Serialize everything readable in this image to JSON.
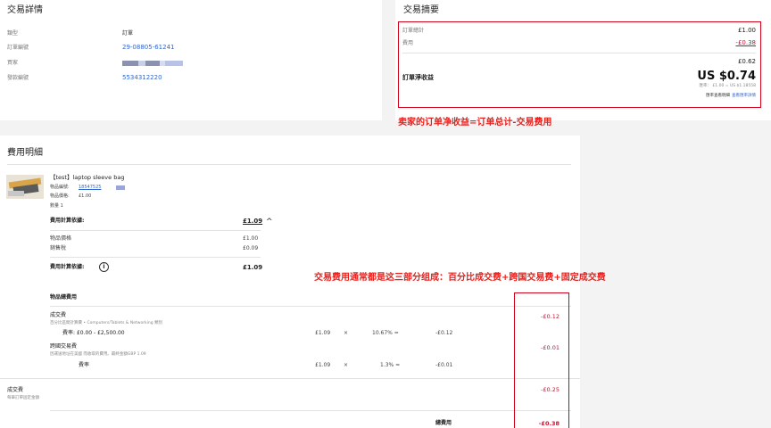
{
  "details": {
    "title": "交易詳情",
    "rows": [
      {
        "label": "類型",
        "value": "訂單"
      },
      {
        "label": "訂單編號",
        "value": "29-08805-61241"
      },
      {
        "label": "買家",
        "value": ""
      },
      {
        "label": "發款編號",
        "value": "5534312220"
      }
    ]
  },
  "summary": {
    "title": "交易摘要",
    "order_total_label": "訂單總計",
    "order_total": "£1.00",
    "fees_label": "費用",
    "fees": "-£0.38",
    "subtotal": "£0.62",
    "net_label": "訂單淨收益",
    "net_value": "US $0.74",
    "rate_note": "匯率： £1.00 = US $1.18558",
    "fine_note": "匯率查看明細",
    "fine_link": "查看匯率詳情"
  },
  "annotations": {
    "top": "卖家的订单净收益=订单总计-交易费用",
    "middle": "交易费用通常都是这三部分组成：百分比成交费+跨国交易费+固定成交费"
  },
  "fee_detail": {
    "title": "費用明細",
    "item": {
      "name": "【test】laptop sleeve bag",
      "id_label": "物品編號:",
      "id_value": "18547525",
      "price_label": "物品價格:",
      "price_value": "£1.00",
      "qty": "數量 1"
    },
    "basis1": {
      "label": "費用計算依據:",
      "value": "£1.09",
      "toggle": "^"
    },
    "basis_rows": [
      {
        "label": "物品價格",
        "value": "£1.00"
      },
      {
        "label": "銷售稅",
        "value": "£0.09"
      }
    ],
    "basis2": {
      "label": "費用計算依據:",
      "info": "i",
      "value": "£1.09"
    },
    "section_label": "物品總費用",
    "final_value": {
      "label": "成交費",
      "desc": "百分比區間計算費 • Computers/Tablets & Networking 類別",
      "rate_label": "費率: £0.00 - £2,500.00",
      "base": "£1.09",
      "times": "×",
      "pct": "10.67% =",
      "result": "-£0.12",
      "total": "-£0.12"
    },
    "intl": {
      "label": "跨國交易費",
      "desc": "因運送地址在美國 而收取的費用。最終金額GBP 1.09",
      "rate_label": "費率",
      "base": "£1.09",
      "times": "×",
      "pct": "1.3% =",
      "result": "-£0.01",
      "total": "-£0.01"
    },
    "fixed": {
      "label": "成交費",
      "desc": "每筆訂單固定金額",
      "total": "-£0.25"
    },
    "total_label": "總費用",
    "total_value": "-£0.38"
  }
}
